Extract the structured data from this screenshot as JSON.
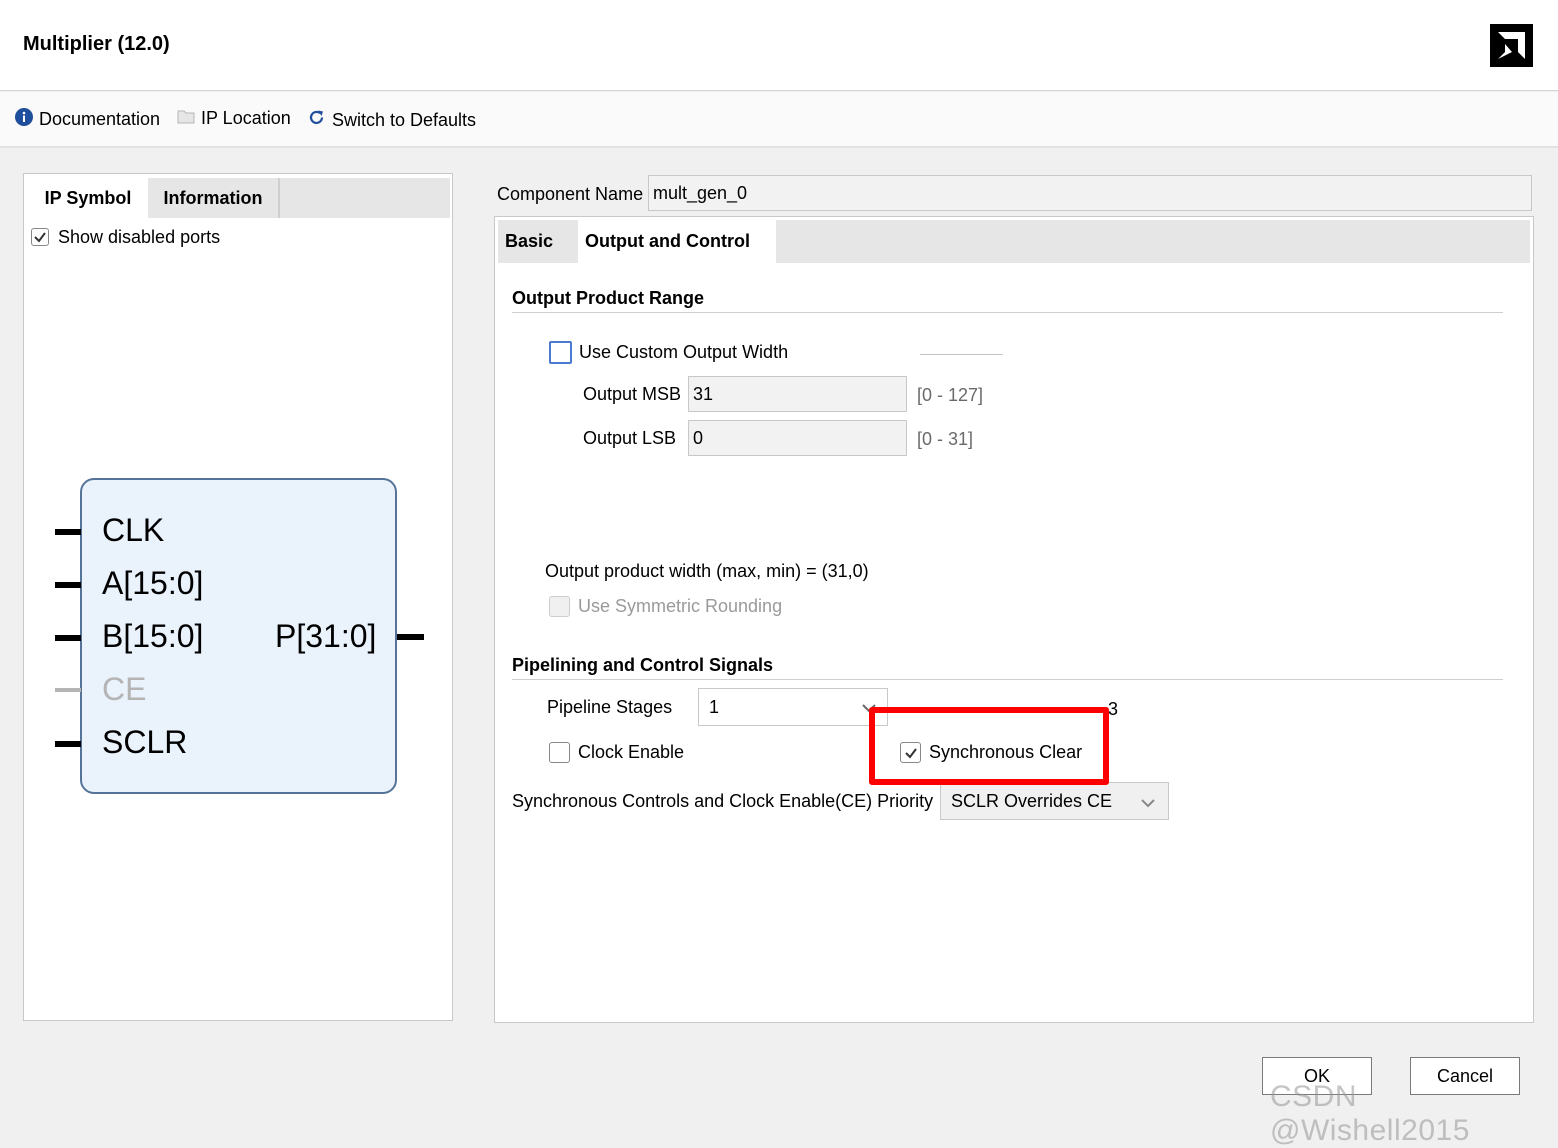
{
  "window": {
    "title": "Multiplier (12.0)",
    "logo": "amd-logo"
  },
  "toolbar": {
    "documentation": "Documentation",
    "ip_location": "IP Location",
    "switch_defaults": "Switch to Defaults",
    "icons": [
      "info-icon",
      "folder-icon",
      "refresh-icon"
    ]
  },
  "left_panel": {
    "tabs": [
      "IP Symbol",
      "Information"
    ],
    "active_tab": "IP Symbol",
    "show_disabled_ports": {
      "label": "Show disabled ports",
      "checked": true
    },
    "symbol": {
      "inputs": [
        "CLK",
        "A[15:0]",
        "B[15:0]",
        "CE",
        "SCLR"
      ],
      "disabled_inputs": [
        "CE"
      ],
      "outputs": [
        "P[31:0]"
      ]
    }
  },
  "right_panel": {
    "component_name_label": "Component Name",
    "component_name": "mult_gen_0",
    "tabs": [
      "Basic",
      "Output and Control"
    ],
    "active_tab": "Output and Control",
    "output_product_range": {
      "title": "Output Product Range",
      "use_custom_width": {
        "label": "Use Custom Output Width",
        "checked": false
      },
      "msb": {
        "label": "Output MSB",
        "value": "31",
        "range": "[0 - 127]"
      },
      "lsb": {
        "label": "Output LSB",
        "value": "0",
        "range": "[0 - 31]"
      },
      "width_text": "Output product width (max, min) = (31,0)",
      "symmetric_rounding": {
        "label": "Use Symmetric Rounding",
        "checked": false,
        "enabled": false
      }
    },
    "pipelining": {
      "title": "Pipelining and Control Signals",
      "pipeline_stages_label": "Pipeline Stages",
      "pipeline_stages_value": "1",
      "optimum_text_visible": "3",
      "clock_enable": {
        "label": "Clock Enable",
        "checked": false
      },
      "sync_clear": {
        "label": "Synchronous Clear",
        "checked": true
      },
      "priority_label": "Synchronous Controls and Clock Enable(CE) Priority",
      "priority_value": "SCLR Overrides CE"
    }
  },
  "buttons": {
    "ok": "OK",
    "cancel": "Cancel"
  },
  "annotation": {
    "highlight_color": "#ff0000"
  },
  "watermark": "CSDN @Wishell2015"
}
